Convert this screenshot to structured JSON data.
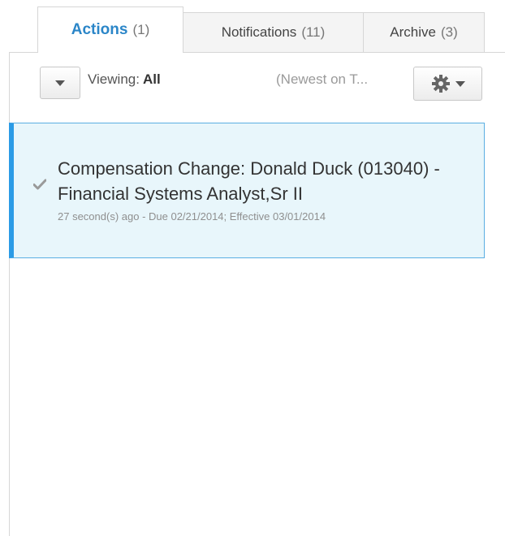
{
  "tabs": {
    "actions": {
      "label": "Actions",
      "count": "(1)"
    },
    "notifications": {
      "label": "Notifications",
      "count": "(11)"
    },
    "archive": {
      "label": "Archive",
      "count": "(3)"
    }
  },
  "toolbar": {
    "viewing_label": "Viewing:",
    "viewing_value": "All",
    "sort_text": "(Newest on T...",
    "dropdown_icon": "chevron-down-icon",
    "settings_icon": "gear-icon"
  },
  "items": [
    {
      "title": "Compensation Change: Donald Duck (013040) - Financial Systems Analyst,Sr II",
      "meta": "27 second(s) ago - Due 02/21/2014; Effective 03/01/2014",
      "status_icon": "checkmark-icon"
    }
  ],
  "colors": {
    "accent": "#2b86c8",
    "item_background": "#e8f6fb",
    "item_border": "#2b9be6"
  }
}
